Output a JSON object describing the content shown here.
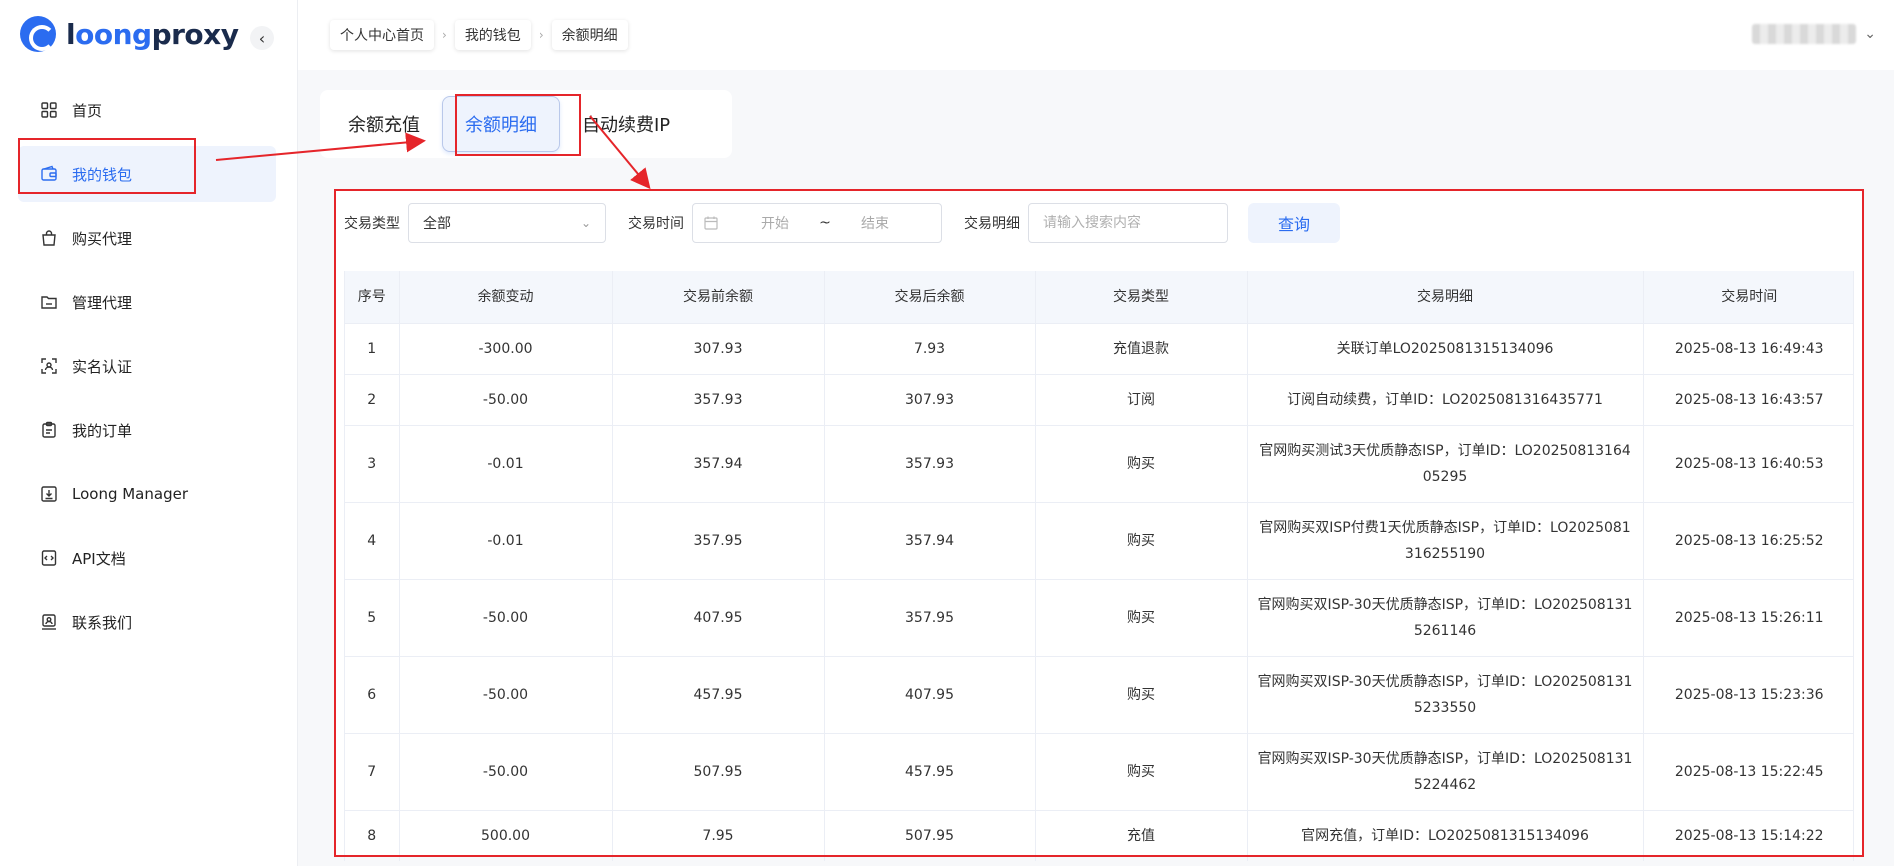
{
  "brand": {
    "name_prefix": "l",
    "name_accent": "oong",
    "name_suffix": "proxy"
  },
  "sidebar": {
    "collapse_label": "‹",
    "items": [
      {
        "label": "首页",
        "icon": "grid-icon"
      },
      {
        "label": "我的钱包",
        "icon": "wallet-icon",
        "active": true
      },
      {
        "label": "购买代理",
        "icon": "shopping-bag-icon"
      },
      {
        "label": "管理代理",
        "icon": "folder-icon"
      },
      {
        "label": "实名认证",
        "icon": "id-scan-icon"
      },
      {
        "label": "我的订单",
        "icon": "clipboard-icon"
      },
      {
        "label": "Loong Manager",
        "icon": "download-icon"
      },
      {
        "label": "API文档",
        "icon": "code-doc-icon"
      },
      {
        "label": "联系我们",
        "icon": "contact-icon"
      }
    ]
  },
  "breadcrumb": [
    "个人中心首页",
    "我的钱包",
    "余额明细"
  ],
  "tabs": [
    "余额充值",
    "余额明细",
    "自动续费IP"
  ],
  "filters": {
    "type_label": "交易类型",
    "type_value": "全部",
    "time_label": "交易时间",
    "time_start": "开始",
    "time_sep": "~",
    "time_end": "结束",
    "detail_label": "交易明细",
    "detail_placeholder": "请输入搜索内容",
    "query_label": "查询"
  },
  "table": {
    "headers": [
      "序号",
      "余额变动",
      "交易前余额",
      "交易后余额",
      "交易类型",
      "交易明细",
      "交易时间"
    ],
    "rows": [
      [
        "1",
        "-300.00",
        "307.93",
        "7.93",
        "充值退款",
        "关联订单LO2025081315134096",
        "2025-08-13 16:49:43"
      ],
      [
        "2",
        "-50.00",
        "357.93",
        "307.93",
        "订阅",
        "订阅自动续费，订单ID：LO2025081316435771",
        "2025-08-13 16:43:57"
      ],
      [
        "3",
        "-0.01",
        "357.94",
        "357.93",
        "购买",
        "官网购买测试3天优质静态ISP，订单ID：LO2025081316405295",
        "2025-08-13 16:40:53"
      ],
      [
        "4",
        "-0.01",
        "357.95",
        "357.94",
        "购买",
        "官网购买双ISP付费1天优质静态ISP，订单ID：LO2025081316255190",
        "2025-08-13 16:25:52"
      ],
      [
        "5",
        "-50.00",
        "407.95",
        "357.95",
        "购买",
        "官网购买双ISP-30天优质静态ISP，订单ID：LO2025081315261146",
        "2025-08-13 15:26:11"
      ],
      [
        "6",
        "-50.00",
        "457.95",
        "407.95",
        "购买",
        "官网购买双ISP-30天优质静态ISP，订单ID：LO2025081315233550",
        "2025-08-13 15:23:36"
      ],
      [
        "7",
        "-50.00",
        "507.95",
        "457.95",
        "购买",
        "官网购买双ISP-30天优质静态ISP，订单ID：LO2025081315224462",
        "2025-08-13 15:22:45"
      ],
      [
        "8",
        "500.00",
        "7.95",
        "507.95",
        "充值",
        "官网充值，订单ID：LO2025081315134096",
        "2025-08-13 15:14:22"
      ]
    ]
  },
  "colors": {
    "accent": "#2b6cf0",
    "annotation": "#e5252a"
  }
}
